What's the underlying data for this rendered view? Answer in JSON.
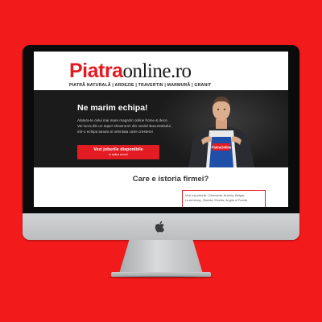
{
  "website": {
    "logo": {
      "brand_red": "Piatra",
      "brand_dark": "online.ro",
      "tagline": "PIATRĂ NATURALĂ | ARDEZIE | TRAVERTIN | MARMURĂ | GRANIT"
    },
    "hero": {
      "title": "Ne marim echipa!",
      "body_lines": [
        "Alatura-te celui mai mare magazin online home & deco.",
        "Vei lucra din un super showroom din nordul Bucurestiului,",
        "intr-o echipa tanara si orientata catre crestere!"
      ],
      "cta_label": "Vezi joburile disponibile",
      "cta_sublabel": "si aplica acum!",
      "shirt_text": "PiatraOnline"
    },
    "about": {
      "heading": "Care e istoria firmei?",
      "info_lines": [
        "Vezi exporturile: Germania, Austria, Belgia,",
        "Luxemburg, Olanda, Elvetia, Anglia si Franta"
      ]
    }
  },
  "colors": {
    "background": "#f21a1a",
    "brand_red": "#e31b23",
    "hero_bg": "#1b1b1b",
    "bezel": "#0b0b0b",
    "aluminium": "#c5c6c8"
  },
  "icons": {
    "device_logo": "apple-icon"
  }
}
